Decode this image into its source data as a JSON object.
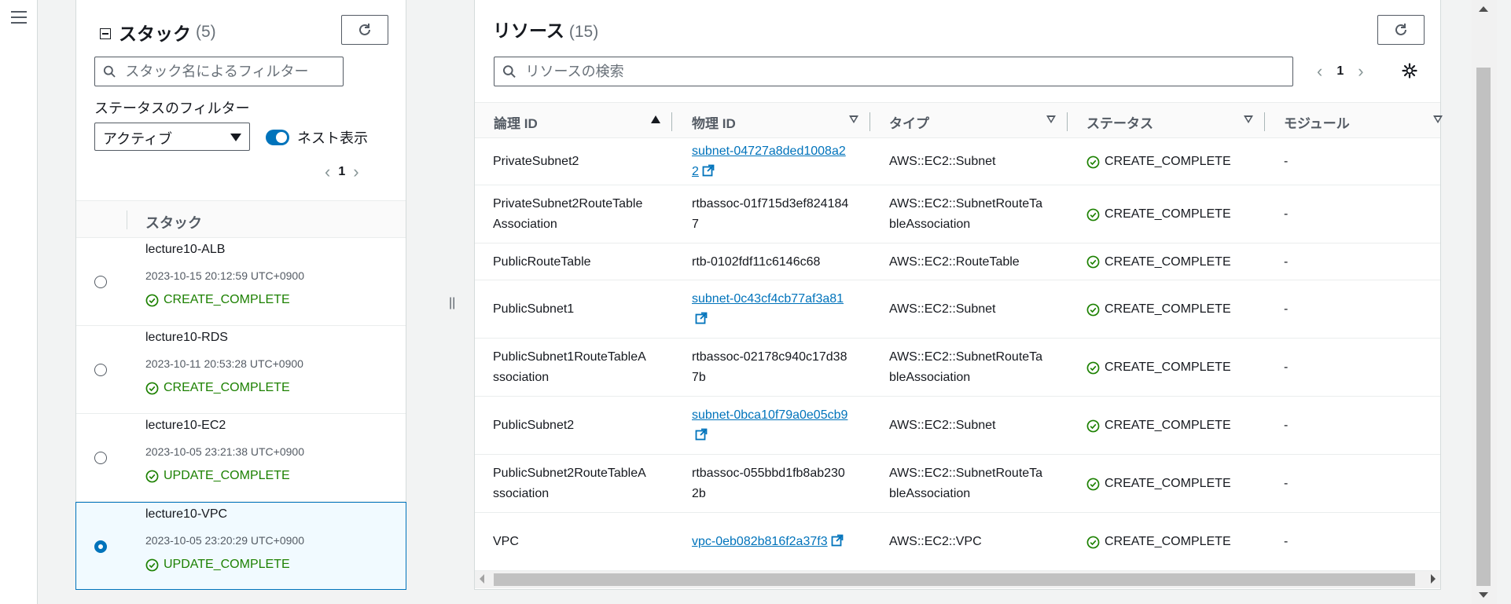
{
  "stacks_panel": {
    "title": "スタック",
    "count": "(5)",
    "search_placeholder": "スタック名によるフィルター",
    "filter_label": "ステータスのフィルター",
    "filter_value": "アクティブ",
    "nested_toggle_label": "ネスト表示",
    "nested_toggle_on": true,
    "page": "1",
    "column_header": "スタック",
    "stacks": [
      {
        "name": "lecture10-ALB",
        "time": "2023-10-15 20:12:59 UTC+0900",
        "status": "CREATE_COMPLETE",
        "selected": false
      },
      {
        "name": "lecture10-RDS",
        "time": "2023-10-11 20:53:28 UTC+0900",
        "status": "CREATE_COMPLETE",
        "selected": false
      },
      {
        "name": "lecture10-EC2",
        "time": "2023-10-05 23:21:38 UTC+0900",
        "status": "UPDATE_COMPLETE",
        "selected": false
      },
      {
        "name": "lecture10-VPC",
        "time": "2023-10-05 23:20:29 UTC+0900",
        "status": "UPDATE_COMPLETE",
        "selected": true
      }
    ]
  },
  "resources_panel": {
    "title": "リソース",
    "count": "(15)",
    "search_placeholder": "リソースの検索",
    "page": "1",
    "columns": {
      "logical_id": "論理 ID",
      "physical_id": "物理 ID",
      "type": "タイプ",
      "status": "ステータス",
      "module": "モジュール"
    },
    "rows": [
      {
        "logical_id": "PrivateSubnet2",
        "physical_id": "subnet-04727a8ded1008a22",
        "physical_link": true,
        "type": "AWS::EC2::Subnet",
        "status": "CREATE_COMPLETE",
        "module": "-"
      },
      {
        "logical_id": "PrivateSubnet2RouteTableAssociation",
        "physical_id": "rtbassoc-01f715d3ef8241847",
        "physical_link": false,
        "type": "AWS::EC2::SubnetRouteTableAssociation",
        "status": "CREATE_COMPLETE",
        "module": "-"
      },
      {
        "logical_id": "PublicRouteTable",
        "physical_id": "rtb-0102fdf11c6146c68",
        "physical_link": false,
        "type": "AWS::EC2::RouteTable",
        "status": "CREATE_COMPLETE",
        "module": "-"
      },
      {
        "logical_id": "PublicSubnet1",
        "physical_id": "subnet-0c43cf4cb77af3a81",
        "physical_link": true,
        "type": "AWS::EC2::Subnet",
        "status": "CREATE_COMPLETE",
        "module": "-"
      },
      {
        "logical_id": "PublicSubnet1RouteTableAssociation",
        "physical_id": "rtbassoc-02178c940c17d387b",
        "physical_link": false,
        "type": "AWS::EC2::SubnetRouteTableAssociation",
        "status": "CREATE_COMPLETE",
        "module": "-"
      },
      {
        "logical_id": "PublicSubnet2",
        "physical_id": "subnet-0bca10f79a0e05cb9",
        "physical_link": true,
        "type": "AWS::EC2::Subnet",
        "status": "CREATE_COMPLETE",
        "module": "-"
      },
      {
        "logical_id": "PublicSubnet2RouteTableAssociation",
        "physical_id": "rtbassoc-055bbd1fb8ab2302b",
        "physical_link": false,
        "type": "AWS::EC2::SubnetRouteTableAssociation",
        "status": "CREATE_COMPLETE",
        "module": "-"
      },
      {
        "logical_id": "VPC",
        "physical_id": "vpc-0eb082b816f2a37f3",
        "physical_link": true,
        "type": "AWS::EC2::VPC",
        "status": "CREATE_COMPLETE",
        "module": "-"
      }
    ]
  },
  "colors": {
    "success": "#1d8102",
    "link": "#0073bb",
    "accent": "#0073bb"
  }
}
